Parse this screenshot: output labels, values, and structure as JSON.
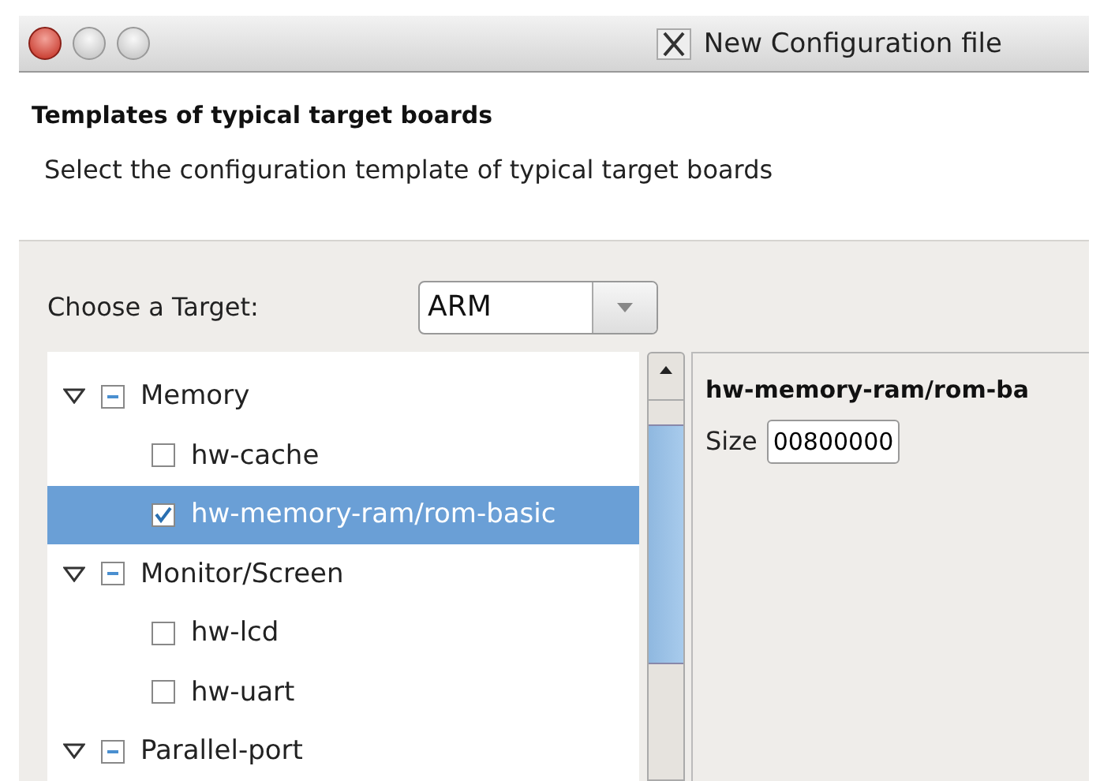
{
  "window": {
    "title": "New Configuration file"
  },
  "header": {
    "title": "Templates of typical target boards",
    "description": "Select the configuration template of typical target boards"
  },
  "target": {
    "label": "Choose a Target:",
    "value": "ARM"
  },
  "tree": [
    {
      "label": "Memory",
      "expanded": true,
      "indeterminate": true,
      "selected": false,
      "children": [
        {
          "label": "hw-cache",
          "checked": false,
          "selected": false
        },
        {
          "label": "hw-memory-ram/rom-basic",
          "checked": true,
          "selected": true
        }
      ]
    },
    {
      "label": "Monitor/Screen",
      "expanded": true,
      "indeterminate": true,
      "selected": false,
      "children": [
        {
          "label": "hw-lcd",
          "checked": false,
          "selected": false
        },
        {
          "label": "hw-uart",
          "checked": false,
          "selected": false
        }
      ]
    },
    {
      "label": "Parallel-port",
      "expanded": true,
      "indeterminate": true,
      "selected": false
    }
  ],
  "details": {
    "title": "hw-memory-ram/rom-ba",
    "fields": [
      {
        "label": "Size",
        "value": "00800000"
      }
    ]
  }
}
